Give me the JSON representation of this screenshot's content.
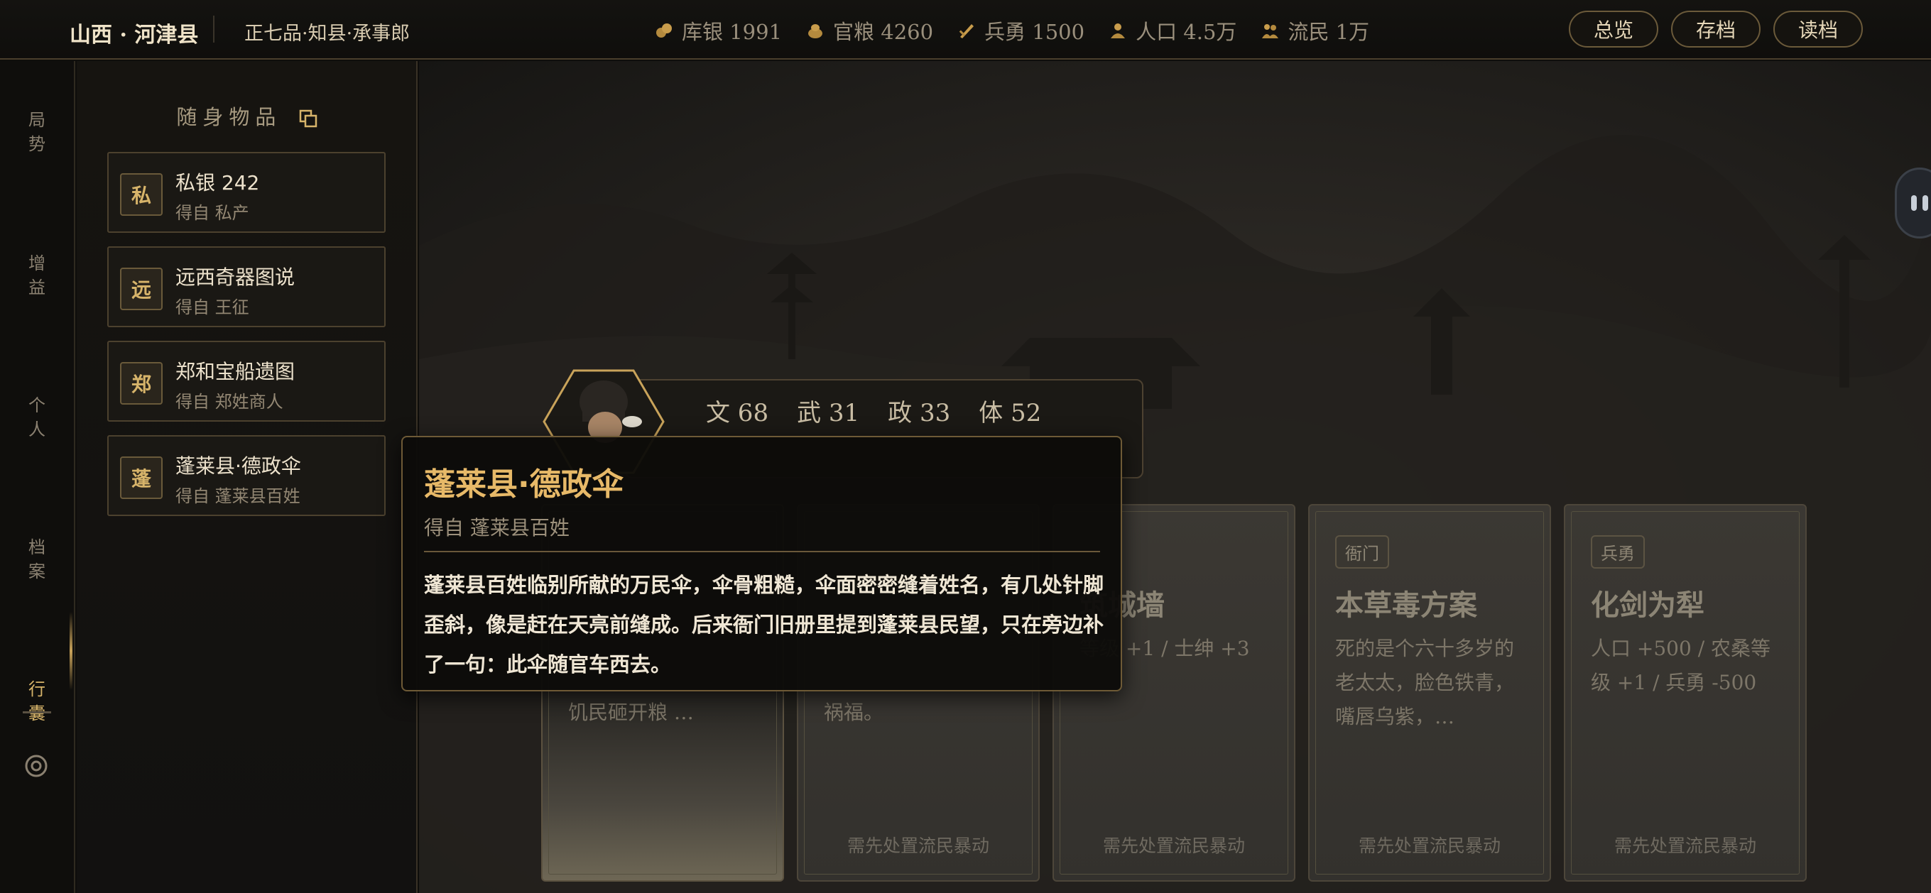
{
  "header": {
    "region": "山西 · 河津县",
    "rank": "正七品·知县·承事郎",
    "stats": [
      {
        "icon": "silver-coins-icon",
        "text": "库银 1991"
      },
      {
        "icon": "grain-icon",
        "text": "官粮 4260"
      },
      {
        "icon": "soldier-icon",
        "text": "兵勇 1500"
      },
      {
        "icon": "population-icon",
        "text": "人口 4.5万"
      },
      {
        "icon": "refugee-icon",
        "text": "流民 1万"
      }
    ],
    "buttons": [
      "总览",
      "存档",
      "读档"
    ]
  },
  "rail": {
    "items": [
      "局\n势",
      "增\n益",
      "个\n人",
      "档\n案",
      "行\n囊"
    ],
    "active_index": 4
  },
  "inventory": {
    "title": "随身物品",
    "items": [
      {
        "badge": "私",
        "name": "私银 242",
        "source": "得自 私产"
      },
      {
        "badge": "远",
        "name": "远西奇器图说",
        "source": "得自 王征"
      },
      {
        "badge": "郑",
        "name": "郑和宝船遗图",
        "source": "得自 郑姓商人"
      },
      {
        "badge": "蓬",
        "name": "蓬莱县·德政伞",
        "source": "得自 蓬莱县百姓"
      }
    ]
  },
  "official": {
    "attributes": [
      "文 68",
      "武 31",
      "政 33",
      "体 52"
    ]
  },
  "events": [
    {
      "tag": "",
      "title": "",
      "desc": "饥民砸开粮 …",
      "foot": ""
    },
    {
      "tag": "",
      "title": "",
      "desc": "祸福。",
      "foot": "需先处置流民暴动"
    },
    {
      "tag": "",
      "title": "筑城墙",
      "desc": "等级 +1 / 士绅 +3",
      "foot": "需先处置流民暴动"
    },
    {
      "tag": "衙门",
      "title": "本草毒方案",
      "desc": "死的是个六十多岁的老太太，脸色铁青，嘴唇乌紫，…",
      "foot": "需先处置流民暴动"
    },
    {
      "tag": "兵勇",
      "title": "化剑为犁",
      "desc": "人口 +500 / 农桑等级 +1 / 兵勇 -500",
      "foot": "需先处置流民暴动"
    }
  ],
  "tooltip": {
    "title": "蓬莱县·德政伞",
    "source": "得自 蓬莱县百姓",
    "body": "蓬莱县百姓临别所献的万民伞，伞骨粗糙，伞面密密缝着姓名，有几处针脚歪斜，像是赶在天亮前缝成。后来衙门旧册里提到蓬莱县民望，只在旁边补了一句：此伞随官车西去。"
  },
  "colors": {
    "accent": "#e7b968",
    "gold": "#d7b46a",
    "bg": "#0e0d0b"
  }
}
